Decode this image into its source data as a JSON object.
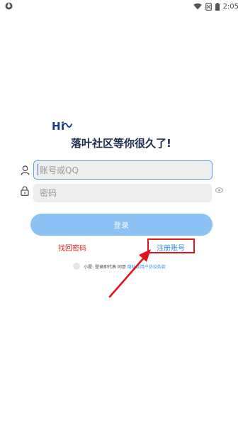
{
  "status_bar": {
    "time": "2:05",
    "icons": [
      "app-icon",
      "wifi-icon",
      "no-sim-icon",
      "battery-icon"
    ]
  },
  "greeting": {
    "logo_text": "Hi",
    "headline": "落叶社区等你很久了!"
  },
  "login_form": {
    "account_placeholder": "账号或QQ",
    "password_placeholder": "密码",
    "login_button_label": "登录"
  },
  "links": {
    "forgot_password": "找回密码",
    "register": "注册账号"
  },
  "agreement": {
    "prefix": "小提:",
    "text": "登录即代表 同意",
    "link_text": "隐私及用户协议条款"
  },
  "colors": {
    "accent": "#8cc1f5",
    "focus_border": "#5aa0e6",
    "link_blue": "#2f8ee0",
    "link_red": "#d9261c",
    "annotation_red": "#e0141a",
    "headline": "#1c2d4e"
  }
}
